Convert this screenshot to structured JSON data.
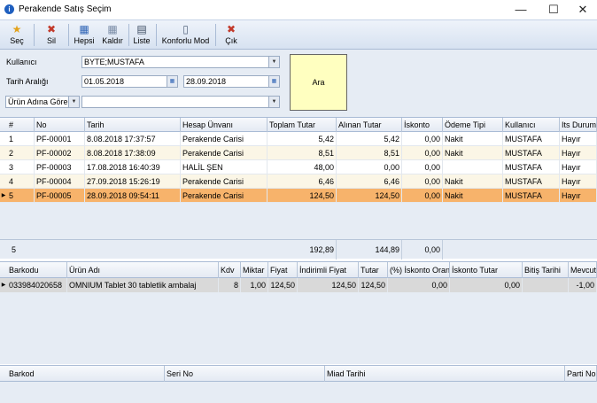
{
  "window": {
    "title": "Perakende Satış Seçim",
    "icon_text": "i",
    "minimize": "—",
    "maximize": "☐",
    "close": "✕"
  },
  "toolbar": {
    "sec": {
      "label": "Seç",
      "icon": "★"
    },
    "sil": {
      "label": "Sil",
      "icon": "✖"
    },
    "hepsi": {
      "label": "Hepsi",
      "icon": "▦"
    },
    "kaldir": {
      "label": "Kaldır",
      "icon": "▦"
    },
    "liste": {
      "label": "Liste",
      "icon": "▤"
    },
    "konforlu": {
      "label": "Konforlu Mod",
      "icon": "▯"
    },
    "cik": {
      "label": "Çık",
      "icon": "✖"
    }
  },
  "filters": {
    "kullanici_label": "Kullanıcı",
    "kullanici_value": "BYTE;MUSTAFA",
    "tarih_label": "Tarih Aralığı",
    "tarih_start": "01.05.2018",
    "tarih_end": "28.09.2018",
    "search_mode": "Ürün Adına Göre",
    "search_value": "",
    "ara_button": "Ara",
    "dropdown_glyph": "▼",
    "calendar_glyph": "▦"
  },
  "sales": {
    "columns": [
      "#",
      "No",
      "Tarih",
      "Hesap Ünvanı",
      "Toplam Tutar",
      "Alınan Tutar",
      "İskonto",
      "Ödeme Tipi",
      "Kullanıcı",
      "Its Durum"
    ],
    "rows": [
      [
        "1",
        "PF-00001",
        "8.08.2018 17:37:57",
        "Perakende Carisi",
        "5,42",
        "5,42",
        "0,00",
        "Nakit",
        "MUSTAFA",
        "Hayır"
      ],
      [
        "2",
        "PF-00002",
        "8.08.2018 17:38:09",
        "Perakende Carisi",
        "8,51",
        "8,51",
        "0,00",
        "Nakit",
        "MUSTAFA",
        "Hayır"
      ],
      [
        "3",
        "PF-00003",
        "17.08.2018 16:40:39",
        "HALİL ŞEN",
        "48,00",
        "0,00",
        "0,00",
        "",
        "MUSTAFA",
        "Hayır"
      ],
      [
        "4",
        "PF-00004",
        "27.09.2018 15:26:19",
        "Perakende Carisi",
        "6,46",
        "6,46",
        "0,00",
        "Nakit",
        "MUSTAFA",
        "Hayır"
      ],
      [
        "5",
        "PF-00005",
        "28.09.2018 09:54:11",
        "Perakende Carisi",
        "124,50",
        "124,50",
        "0,00",
        "Nakit",
        "MUSTAFA",
        "Hayır"
      ]
    ],
    "selected_row": 4,
    "footer": {
      "count": "5",
      "toplam": "192,89",
      "alinan": "144,89",
      "iskonto": "0,00"
    },
    "row_pointer": "▶",
    "selected_color": "#f7b36b"
  },
  "items": {
    "columns": [
      "Barkodu",
      "Ürün Adı",
      "Kdv",
      "Miktar",
      "Fiyat",
      "İndirimli Fiyat",
      "Tutar",
      "(%) İskonto Oranı",
      "İskonto Tutar",
      "Bitiş Tarihi",
      "Mevcut"
    ],
    "rows": [
      [
        "033984020658",
        "OMNIUM Tablet 30 tabletlik ambalaj",
        "8",
        "1,00",
        "124,50",
        "124,50",
        "124,50",
        "0,00",
        "0,00",
        "",
        "-1,00"
      ]
    ],
    "row_pointer": "▶"
  },
  "serials": {
    "columns": [
      "Barkod",
      "Seri No",
      "Miad Tarihi",
      "Parti No"
    ]
  }
}
